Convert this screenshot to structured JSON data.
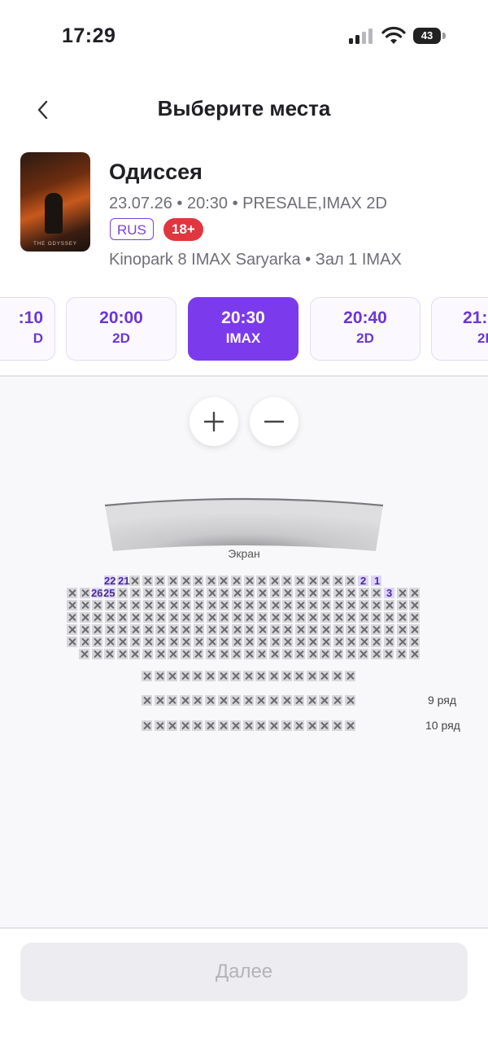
{
  "status_bar": {
    "time": "17:29",
    "battery": "43"
  },
  "header": {
    "title": "Выберите места",
    "back_icon": "chevron-left-icon"
  },
  "movie": {
    "title": "Одиссея",
    "info": "23.07.26 • 20:30 • PRESALE,IMAX 2D",
    "language_badge": "RUS",
    "age_badge": "18+",
    "venue": "Kinopark 8 IMAX Saryarka • Зал 1 IMAX",
    "poster_caption": "THE ODYSSEY"
  },
  "sessions": [
    {
      "time": ":10",
      "format": "D",
      "active": false
    },
    {
      "time": "20:00",
      "format": "2D",
      "active": false
    },
    {
      "time": "20:30",
      "format": "IMAX",
      "active": true
    },
    {
      "time": "20:40",
      "format": "2D",
      "active": false
    },
    {
      "time": "21:",
      "format": "2D",
      "active": false
    }
  ],
  "hall": {
    "screen_label": "Экран",
    "zoom_in_icon": "plus-icon",
    "zoom_out_icon": "minus-icon",
    "row_labels": {
      "row9": "9 ряд",
      "row10": "10 ряд"
    },
    "seat_numbers": {
      "n22": "22",
      "n21": "21",
      "n26": "26",
      "n25": "25",
      "n2": "2",
      "n1": "1",
      "n3": "3"
    },
    "available_seats": [
      "row1-seat1",
      "row1-seat2",
      "row1-seat21",
      "row1-seat22",
      "row2-seat3",
      "row2-seat25",
      "row2-seat26"
    ]
  },
  "footer": {
    "next_label": "Далее"
  },
  "colors": {
    "accent": "#7c3aed",
    "age_badge": "#e0363f",
    "seat_taken": "#d7d7da",
    "seat_free": "#ddd3fb"
  }
}
